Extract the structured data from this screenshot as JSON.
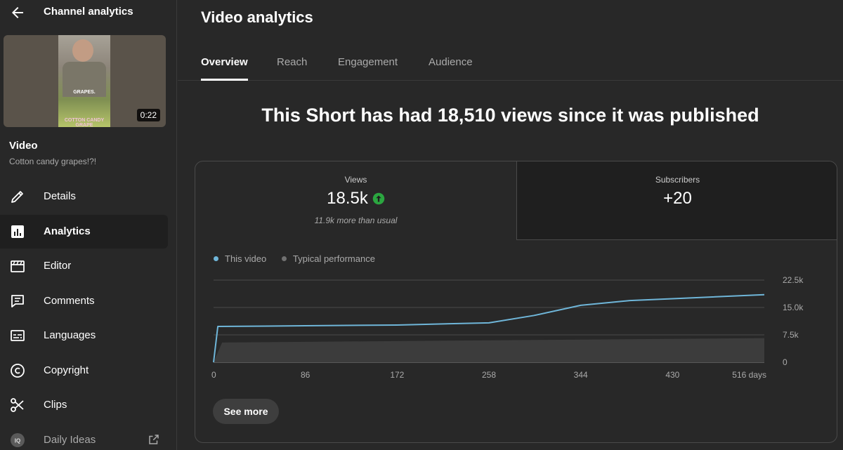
{
  "sidebar": {
    "title": "Channel analytics",
    "thumbnail": {
      "duration": "0:22",
      "overlay_text_1": "GRAPES.",
      "overlay_text_2": "COTTON CANDY GRAPE"
    },
    "video_label": "Video",
    "video_title": "Cotton candy grapes!?!",
    "items": [
      {
        "label": "Details",
        "icon": "pencil-icon"
      },
      {
        "label": "Analytics",
        "icon": "analytics-icon",
        "active": true
      },
      {
        "label": "Editor",
        "icon": "clapperboard-icon"
      },
      {
        "label": "Comments",
        "icon": "comment-icon"
      },
      {
        "label": "Languages",
        "icon": "subtitles-icon"
      },
      {
        "label": "Copyright",
        "icon": "copyright-icon"
      },
      {
        "label": "Clips",
        "icon": "scissors-icon"
      },
      {
        "label": "Daily Ideas",
        "icon": "iq-icon",
        "external": true
      }
    ]
  },
  "main": {
    "title": "Video analytics",
    "tabs": [
      {
        "label": "Overview",
        "active": true
      },
      {
        "label": "Reach"
      },
      {
        "label": "Engagement"
      },
      {
        "label": "Audience"
      }
    ],
    "headline": "This Short has had 18,510 views since it was published",
    "metrics": {
      "views": {
        "label": "Views",
        "value": "18.5k",
        "sub": "11.9k more than usual"
      },
      "subscribers": {
        "label": "Subscribers",
        "value": "+20"
      }
    },
    "legend": {
      "this_video": "This video",
      "typical": "Typical performance"
    },
    "see_more": "See more"
  },
  "colors": {
    "series": "#6fb6d9",
    "typical_dot": "#717171",
    "up_badge": "#2ba640"
  },
  "chart_data": {
    "type": "line",
    "x_unit_label": "516 days",
    "x_ticks": [
      "0",
      "86",
      "172",
      "258",
      "344",
      "430",
      "516 days"
    ],
    "y_ticks": [
      "0",
      "7.5k",
      "15.0k",
      "22.5k"
    ],
    "ylim": [
      0,
      22500
    ],
    "xlim": [
      0,
      516
    ],
    "series": [
      {
        "name": "This video",
        "x": [
          0,
          4,
          86,
          172,
          258,
          300,
          344,
          390,
          430,
          516
        ],
        "y": [
          0,
          9800,
          10000,
          10200,
          10800,
          12800,
          15600,
          16900,
          17400,
          18510
        ]
      }
    ],
    "typical_band": {
      "name": "Typical performance",
      "x": [
        0,
        8,
        172,
        344,
        516
      ],
      "y": [
        0,
        5400,
        5800,
        6200,
        6600
      ]
    }
  }
}
